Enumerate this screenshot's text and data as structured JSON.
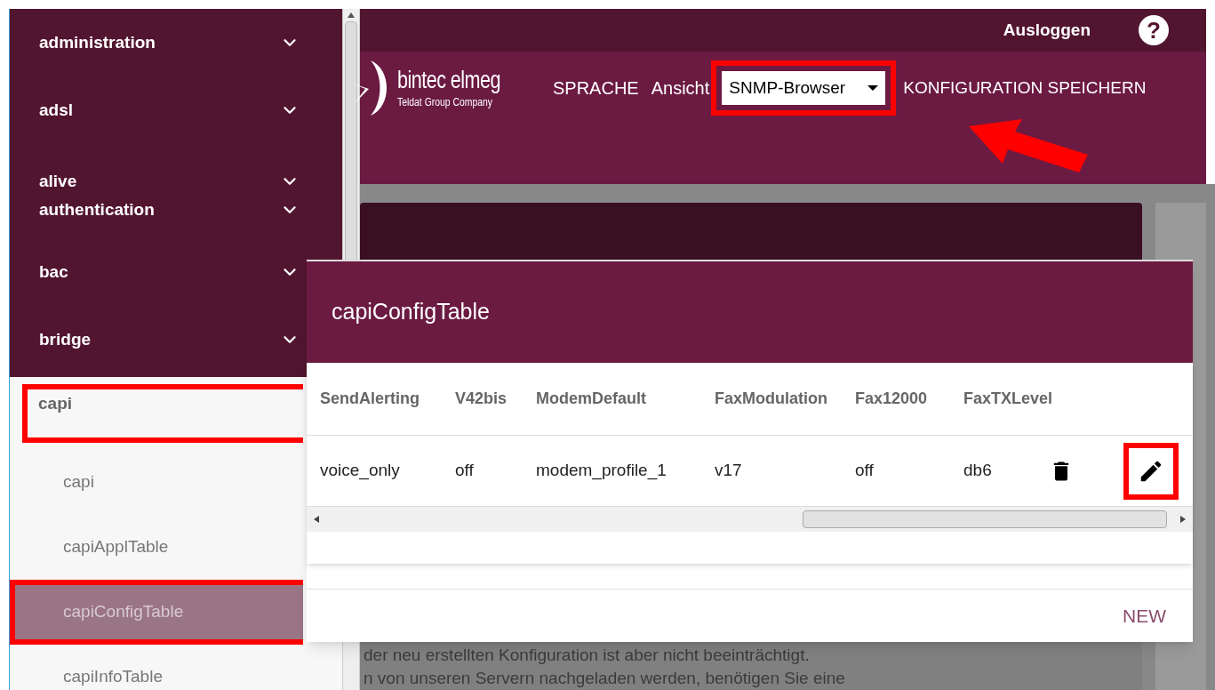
{
  "topbar": {
    "logout": "Ausloggen",
    "help": "?"
  },
  "header": {
    "logo_name": "bintec elmeg",
    "logo_sub": "Teldat Group Company",
    "nav": [
      "SPRACHE",
      "Ansicht"
    ],
    "view_select": {
      "value": "SNMP-Browser",
      "highlighted": true
    },
    "save": "KONFIGURATION SPEICHERN",
    "arrow": true
  },
  "sidebar": {
    "items": [
      {
        "label": "administration",
        "expanded": false
      },
      {
        "label": "adsl",
        "expanded": false
      },
      {
        "label": "alive",
        "expanded": false
      },
      {
        "label": "authentication",
        "expanded": false
      },
      {
        "label": "bac",
        "expanded": false
      },
      {
        "label": "bridge",
        "expanded": false
      },
      {
        "label": "capi",
        "expanded": true,
        "highlighted": true,
        "children": [
          {
            "label": "capi",
            "selected": false,
            "highlighted": false
          },
          {
            "label": "capiApplTable",
            "selected": false,
            "highlighted": false
          },
          {
            "label": "capiConfigTable",
            "selected": true,
            "highlighted": true
          },
          {
            "label": "capiInfoTable",
            "selected": false,
            "highlighted": false
          }
        ]
      }
    ]
  },
  "background_text": [
    "der neu erstellten Konfiguration ist aber nicht beeinträchtigt.",
    "n von unseren Servern nachgeladen werden, benötigen Sie eine"
  ],
  "dialog": {
    "title": "capiConfigTable",
    "columns": [
      "SendAlerting",
      "V42bis",
      "ModemDefault",
      "FaxModulation",
      "Fax12000",
      "FaxTXLevel"
    ],
    "rows": [
      {
        "cells": [
          "voice_only",
          "off",
          "modem_profile_1",
          "v17",
          "off",
          "db6"
        ],
        "edit_highlighted": true
      }
    ],
    "new": "NEW"
  }
}
